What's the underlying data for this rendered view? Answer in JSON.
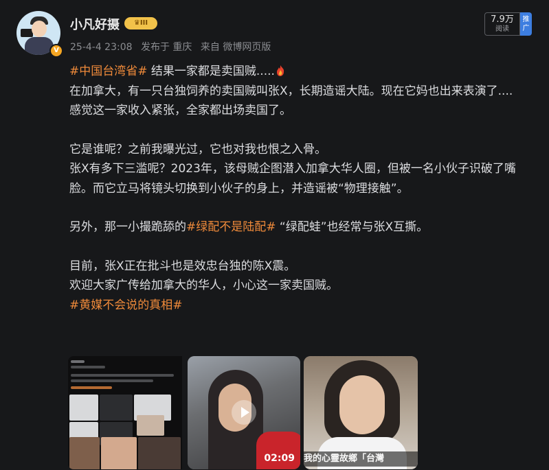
{
  "author": {
    "name": "小凡好摄",
    "level_badge": "III",
    "verified_badge": "V"
  },
  "meta": {
    "date": "25-4-4 23:08",
    "published_in": "发布于 重庆",
    "source": "来自 微博网页版"
  },
  "stats": {
    "reads_value": "7.9万",
    "reads_label": "阅读",
    "promote_label": "推广"
  },
  "post": {
    "tag1": "#中国台湾省#",
    "line1": " 结果一家都是卖国贼.....",
    "line2": "在加拿大，有一只台独饲养的卖国贼叫张X，长期造谣大陆。现在它妈也出来表演了....",
    "line3": "感觉这一家收入紧张，全家都出场卖国了。",
    "line4": "它是谁呢？之前我曝光过，它也对我也恨之入骨。",
    "line5": "张X有多下三滥呢？2023年，该母贼企图潜入加拿大华人圈，但被一名小伙子识破了嘴脸。而它立马将镜头切换到小伙子的身上，并造谣被“物理接触”。",
    "line6_pre": "另外，那一小撮跪舔的",
    "tag2": "#绿配不是陆配#",
    "line6_post": " “绿配蛙”也经常与张X互撕。",
    "line7": "目前，张X正在批斗也是效忠台独的陈X震。",
    "line8": "欢迎大家广传给加拿大的华人，小心这一家卖国贼。",
    "tag3": "#黄媒不会说的真相#"
  },
  "media": {
    "video_duration": "02:09",
    "subtitle": "我的心靈故鄉「台灣"
  },
  "colors": {
    "background": "#17181a",
    "tag": "#ef8a3a",
    "text": "#dcdde0",
    "meta": "#8b8d91",
    "promote": "#3d7ee0"
  },
  "icons": [
    "fire-emoji-icon",
    "crown-icon",
    "play-icon",
    "verified-icon"
  ]
}
